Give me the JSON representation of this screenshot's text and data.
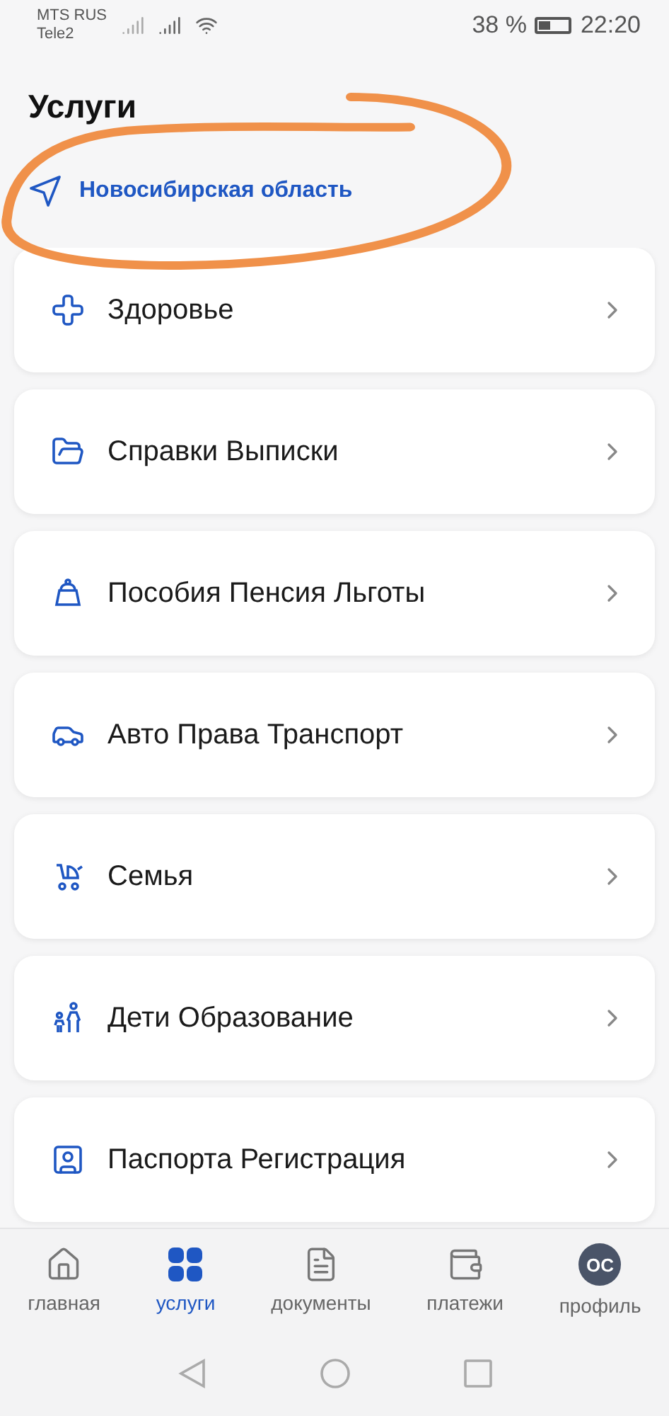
{
  "status_bar": {
    "carrier_1": "MTS RUS",
    "carrier_2": "Tele2",
    "battery": "38 %",
    "time": "22:20"
  },
  "title": "Услуги",
  "location": "Новосибирская область",
  "categories": [
    {
      "kind": "health",
      "label": "Здоровье"
    },
    {
      "kind": "documents",
      "label": "Справки Выписки"
    },
    {
      "kind": "benefits",
      "label": "Пособия Пенсия Льготы"
    },
    {
      "kind": "auto",
      "label": "Авто Права Транспорт"
    },
    {
      "kind": "family",
      "label": "Семья"
    },
    {
      "kind": "children",
      "label": "Дети Образование"
    },
    {
      "kind": "passport",
      "label": "Паспорта Регистрация"
    }
  ],
  "bottom_nav": [
    {
      "kind": "home",
      "label": "главная",
      "selected": false
    },
    {
      "kind": "services",
      "label": "услуги",
      "selected": true
    },
    {
      "kind": "docs",
      "label": "документы",
      "selected": false
    },
    {
      "kind": "payments",
      "label": "платежи",
      "selected": false
    },
    {
      "kind": "profile",
      "label": "профиль",
      "avatar": "ОС",
      "selected": false
    }
  ]
}
